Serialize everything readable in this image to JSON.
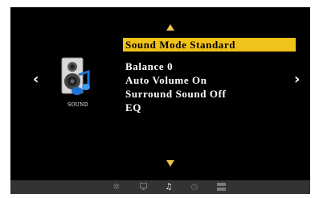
{
  "source_label": "SOUND",
  "menu": {
    "items": [
      {
        "label": "Sound Mode Standard",
        "selected": true
      },
      {
        "label": "Balance 0",
        "selected": false
      },
      {
        "label": "Auto Volume On",
        "selected": false
      },
      {
        "label": "Surround Sound Off",
        "selected": false
      },
      {
        "label": "EQ",
        "selected": false
      }
    ]
  },
  "bottom_bar": {
    "icons": [
      {
        "name": "picture-icon",
        "active": false
      },
      {
        "name": "display-icon",
        "active": false
      },
      {
        "name": "music-note-icon",
        "active": true
      },
      {
        "name": "clock-icon",
        "active": false
      },
      {
        "name": "settings-icon",
        "active": false
      }
    ]
  },
  "colors": {
    "highlight": "#f0c21a",
    "arrow": "#e9c54d",
    "background": "#000000",
    "bar": "#333333"
  }
}
